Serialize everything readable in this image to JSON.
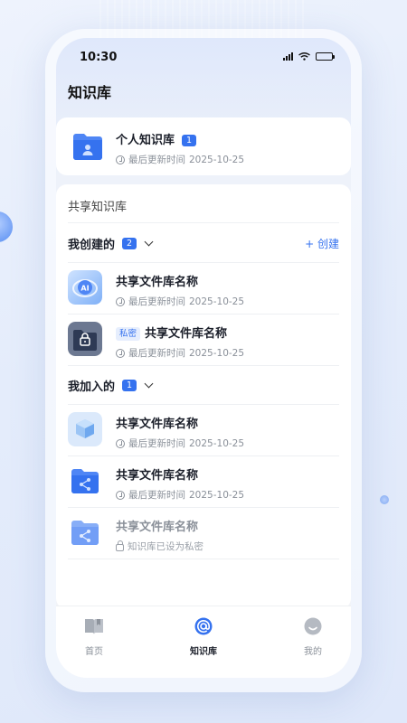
{
  "status_bar": {
    "time": "10:30"
  },
  "header": {
    "title": "知识库"
  },
  "personal": {
    "title": "个人知识库",
    "badge": "1",
    "meta_label": "最后更新时间",
    "meta_date": "2025-10-25"
  },
  "shared": {
    "heading": "共享知识库",
    "created_section": {
      "label": "我创建的",
      "count": "2",
      "create_label": "+ 创建"
    },
    "created_items": [
      {
        "title": "共享文件库名称",
        "meta_label": "最后更新时间",
        "meta_date": "2025-10-25",
        "icon": "ai-icon"
      },
      {
        "title": "共享文件库名称",
        "tag": "私密",
        "meta_label": "最后更新时间",
        "meta_date": "2025-10-25",
        "icon": "lock-folder-icon"
      }
    ],
    "joined_section": {
      "label": "我加入的",
      "count": "1"
    },
    "joined_items": [
      {
        "title": "共享文件库名称",
        "meta_label": "最后更新时间",
        "meta_date": "2025-10-25",
        "icon": "cube-icon"
      },
      {
        "title": "共享文件库名称",
        "meta_label": "最后更新时间",
        "meta_date": "2025-10-25",
        "icon": "shared-folder-icon"
      },
      {
        "title": "共享文件库名称",
        "meta_text": "知识库已设为私密",
        "icon": "shared-folder-icon"
      }
    ]
  },
  "tabbar": {
    "tabs": [
      {
        "label": "首页",
        "icon": "book-icon"
      },
      {
        "label": "知识库",
        "icon": "at-icon",
        "active": true
      },
      {
        "label": "我的",
        "icon": "smile-icon"
      }
    ]
  },
  "colors": {
    "accent": "#3572ef",
    "text": "#1b1f2a",
    "muted": "#8a9099"
  }
}
